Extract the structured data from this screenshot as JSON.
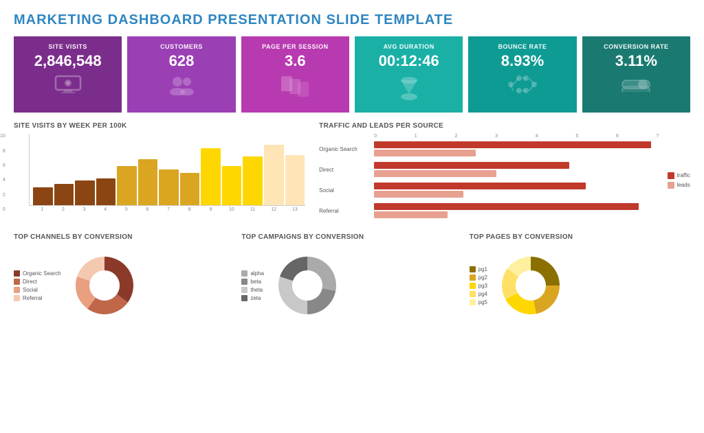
{
  "title": "MARKETING DASHBOARD PRESENTATION SLIDE TEMPLATE",
  "kpis": [
    {
      "id": "site-visits",
      "label": "SITE VISITS",
      "value": "2,846,548",
      "icon": "💻",
      "color": "purple"
    },
    {
      "id": "customers",
      "label": "CUSTOMERS",
      "value": "628",
      "icon": "👥",
      "color": "violet"
    },
    {
      "id": "page-per-session",
      "label": "PAGE PER SESSION",
      "value": "3.6",
      "icon": "📄",
      "color": "magenta"
    },
    {
      "id": "avg-duration",
      "label": "AVG DURATION",
      "value": "00:12:46",
      "icon": "⏳",
      "color": "teal"
    },
    {
      "id": "bounce-rate",
      "label": "BOUNCE RATE",
      "value": "8.93%",
      "icon": "↗",
      "color": "cyan"
    },
    {
      "id": "conversion-rate",
      "label": "CONVERSION RATE",
      "value": "3.11%",
      "icon": "🔘",
      "color": "dark-teal"
    }
  ],
  "bar_chart": {
    "title": "SITE VISITS by Week per 100k",
    "y_labels": [
      "10",
      "8",
      "6",
      "4",
      "2",
      "0"
    ],
    "x_labels": [
      "1",
      "2",
      "3",
      "4",
      "5",
      "6",
      "7",
      "8",
      "9",
      "10",
      "11",
      "12",
      "13"
    ],
    "bars": [
      {
        "week": 1,
        "val": 25,
        "color": "#8B4513"
      },
      {
        "week": 2,
        "val": 30,
        "color": "#8B4513"
      },
      {
        "week": 3,
        "val": 35,
        "color": "#8B4513"
      },
      {
        "week": 4,
        "val": 38,
        "color": "#8B4513"
      },
      {
        "week": 5,
        "val": 55,
        "color": "#DAA520"
      },
      {
        "week": 6,
        "val": 65,
        "color": "#DAA520"
      },
      {
        "week": 7,
        "val": 50,
        "color": "#DAA520"
      },
      {
        "week": 8,
        "val": 45,
        "color": "#DAA520"
      },
      {
        "week": 9,
        "val": 80,
        "color": "#FFD700"
      },
      {
        "week": 10,
        "val": 55,
        "color": "#FFD700"
      },
      {
        "week": 11,
        "val": 68,
        "color": "#FFD700"
      },
      {
        "week": 12,
        "val": 85,
        "color": "#FFE4B5"
      },
      {
        "week": 13,
        "val": 70,
        "color": "#FFE4B5"
      }
    ]
  },
  "hbar_chart": {
    "title": "TRAFFIC and LEADS Per Source",
    "sources": [
      "Organic Search",
      "Direct",
      "Social",
      "Referral"
    ],
    "x_labels": [
      "0",
      "1",
      "2",
      "3",
      "4",
      "5",
      "6",
      "7"
    ],
    "traffic": [
      6.8,
      4.8,
      5.2,
      6.5
    ],
    "leads": [
      2.5,
      3.0,
      2.2,
      1.8
    ],
    "legend": {
      "traffic_label": "traffic",
      "leads_label": "leads"
    }
  },
  "donut_channels": {
    "title": "TOP CHANNELS by Conversion",
    "segments": [
      {
        "label": "Organic Search",
        "color": "#8B3A2A",
        "pct": 35
      },
      {
        "label": "Direct",
        "color": "#C0674A",
        "pct": 25
      },
      {
        "label": "Social",
        "color": "#E8A080",
        "pct": 20
      },
      {
        "label": "Referral",
        "color": "#F4C9B0",
        "pct": 20
      }
    ]
  },
  "donut_campaigns": {
    "title": "TOP CAMPAIGNS by Conversion",
    "segments": [
      {
        "label": "alpha",
        "color": "#AAAAAA",
        "pct": 28
      },
      {
        "label": "beta",
        "color": "#888888",
        "pct": 22
      },
      {
        "label": "theta",
        "color": "#C8C8C8",
        "pct": 30
      },
      {
        "label": "zeta",
        "color": "#666666",
        "pct": 20
      }
    ]
  },
  "donut_pages": {
    "title": "TOP PAGES by Conversion",
    "segments": [
      {
        "label": "pg1",
        "color": "#8B7000",
        "pct": 25
      },
      {
        "label": "pg2",
        "color": "#DAA520",
        "pct": 22
      },
      {
        "label": "pg3",
        "color": "#FFD700",
        "pct": 20
      },
      {
        "label": "pg4",
        "color": "#FFE066",
        "pct": 18
      },
      {
        "label": "pg5",
        "color": "#FFF0A0",
        "pct": 15
      }
    ]
  }
}
